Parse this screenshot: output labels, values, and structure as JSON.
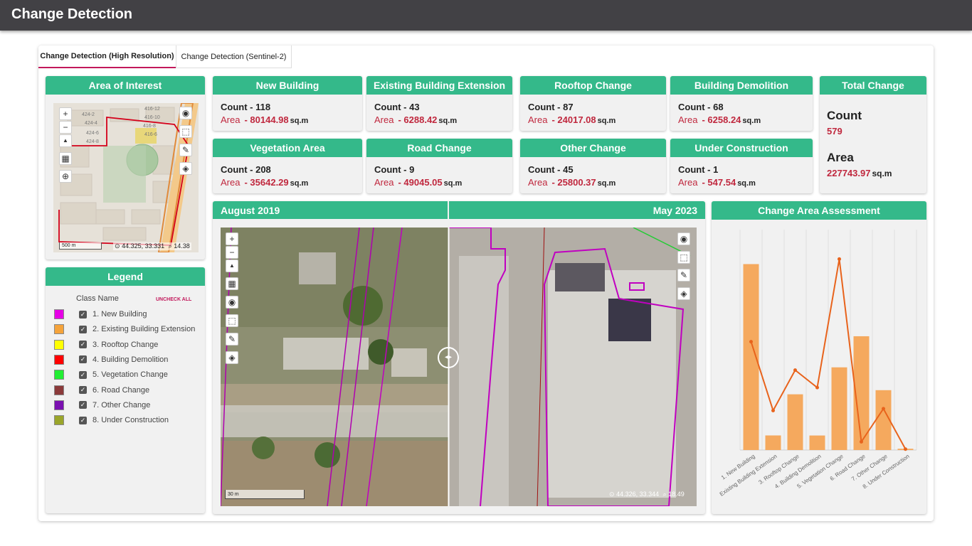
{
  "app": {
    "title": "Change Detection"
  },
  "tabs": [
    {
      "label": "Change Detection (High Resolution)",
      "active": true
    },
    {
      "label": "Change Detection (Sentinel-2)",
      "active": false
    }
  ],
  "aoi": {
    "title": "Area of Interest",
    "scale": "500 m",
    "coords": "44.325, 33.331",
    "zoom": "14.38",
    "map_labels": [
      "416-12",
      "424-4",
      "416-10",
      "424-6",
      "416-8",
      "424-8",
      "416-6",
      "424-2"
    ]
  },
  "stats": {
    "count_prefix": "Count - ",
    "area_label": "Area",
    "area_prefix": "- ",
    "area_unit": "sq.m",
    "cards": [
      {
        "title": "New Building",
        "count": "118",
        "area": "80144.98"
      },
      {
        "title": "Existing Building Extension",
        "count": "43",
        "area": "6288.42"
      },
      {
        "title": "Rooftop Change",
        "count": "87",
        "area": "24017.08"
      },
      {
        "title": "Building Demolition",
        "count": "68",
        "area": "6258.24"
      },
      {
        "title": "Vegetation Area",
        "count": "208",
        "area": "35642.29"
      },
      {
        "title": "Road Change",
        "count": "9",
        "area": "49045.05"
      },
      {
        "title": "Other Change",
        "count": "45",
        "area": "25800.37"
      },
      {
        "title": "Under Construction",
        "count": "1",
        "area": "547.54"
      }
    ]
  },
  "total": {
    "title": "Total Change",
    "count_label": "Count",
    "count": "579",
    "area_label": "Area",
    "area": "227743.97",
    "area_unit": "sq.m"
  },
  "legend": {
    "title": "Legend",
    "class_header": "Class Name",
    "uncheck_all": "UNCHECK ALL",
    "check_mark": "✓",
    "items": [
      {
        "label": "1. New Building",
        "color": "#e600e6",
        "checked": true
      },
      {
        "label": "2. Existing Building Extension",
        "color": "#f5a33a",
        "checked": true
      },
      {
        "label": "3. Rooftop Change",
        "color": "#ffff00",
        "checked": true
      },
      {
        "label": "4. Building Demolition",
        "color": "#ff0000",
        "checked": true
      },
      {
        "label": "5. Vegetation Change",
        "color": "#22ee33",
        "checked": true
      },
      {
        "label": "6. Road Change",
        "color": "#8b3a3a",
        "checked": true
      },
      {
        "label": "7. Other Change",
        "color": "#7a10b0",
        "checked": true
      },
      {
        "label": "8. Under Construction",
        "color": "#9aa52a",
        "checked": true
      }
    ]
  },
  "compare": {
    "left_date": "August 2019",
    "right_date": "May 2023",
    "scale": "30 m",
    "coords": "44.326, 33.344",
    "zoom": "18.49"
  },
  "map_controls": {
    "zoom_in": "+",
    "zoom_out": "−",
    "north": "▲",
    "grid": "▦",
    "camera": "◉",
    "select": "⬚",
    "pick": "✎",
    "layers": "◈",
    "search": "⌕",
    "pin": "⊙",
    "mag": "⊕",
    "split": "◂▸"
  },
  "icons": [
    "zoom-in-icon",
    "zoom-out-icon",
    "compass-icon",
    "grid-icon",
    "camera-icon",
    "selection-icon",
    "eyedropper-icon",
    "layers-icon",
    "location-pin-icon",
    "magnifier-icon",
    "split-handle-icon"
  ],
  "colors": {
    "accent": "#34b98a",
    "topbar": "#424145",
    "value_red": "#c0283e",
    "bar": "#f5a95e",
    "line": "#e8631c",
    "tab_underline": "#c2185b"
  },
  "chart_data": {
    "type": "bar",
    "title": "Change Area Assessment",
    "categories": [
      "1. New Building",
      "Existing Building Extension",
      "3. Rooftop Change",
      "4. Building Demolition",
      "5. Vegetation Change",
      "6. Road Change",
      "7. Other Change",
      "8. Under Construction"
    ],
    "series": [
      {
        "type": "bar",
        "values": [
          80144.98,
          6288.42,
          24017.08,
          6258.24,
          35642.29,
          49045.05,
          25800.37,
          547.54
        ]
      },
      {
        "type": "line",
        "values": [
          118,
          43,
          87,
          68,
          208,
          9,
          45,
          1
        ]
      }
    ],
    "ylim": [
      0,
      95000
    ],
    "ylim_line": [
      0,
      240
    ],
    "grid": true,
    "legend": "none"
  }
}
